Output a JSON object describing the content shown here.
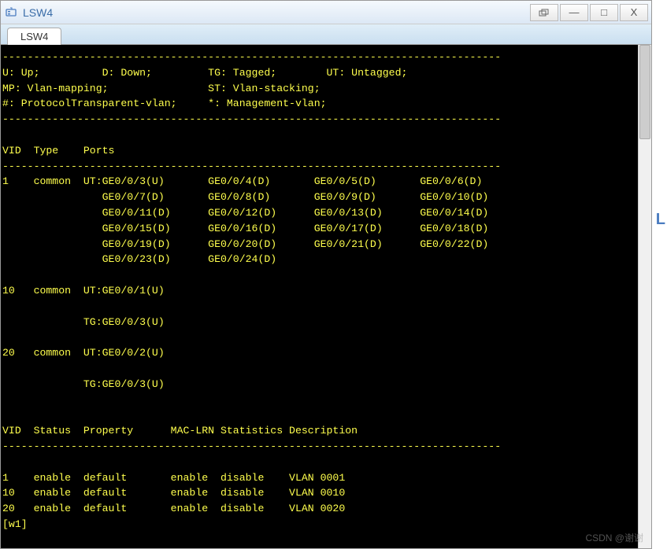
{
  "window": {
    "title": "LSW4",
    "tab": "LSW4"
  },
  "controls": {
    "extra": "▭",
    "minimize": "—",
    "maximize": "□",
    "close": "X"
  },
  "terminal": {
    "dashline": "--------------------------------------------------------------------------------",
    "legend": {
      "l1": "U: Up;          D: Down;         TG: Tagged;        UT: Untagged;",
      "l2": "MP: Vlan-mapping;                ST: Vlan-stacking;",
      "l3": "#: ProtocolTransparent-vlan;     *: Management-vlan;"
    },
    "headers": {
      "ports": "VID  Type    Ports",
      "status": "VID  Status  Property      MAC-LRN Statistics Description"
    },
    "vlan_ports": [
      "1    common  UT:GE0/0/3(U)       GE0/0/4(D)       GE0/0/5(D)       GE0/0/6(D)",
      "                GE0/0/7(D)       GE0/0/8(D)       GE0/0/9(D)       GE0/0/10(D)",
      "                GE0/0/11(D)      GE0/0/12(D)      GE0/0/13(D)      GE0/0/14(D)",
      "                GE0/0/15(D)      GE0/0/16(D)      GE0/0/17(D)      GE0/0/18(D)",
      "                GE0/0/19(D)      GE0/0/20(D)      GE0/0/21(D)      GE0/0/22(D)",
      "                GE0/0/23(D)      GE0/0/24(D)",
      "",
      "10   common  UT:GE0/0/1(U)",
      "",
      "             TG:GE0/0/3(U)",
      "",
      "20   common  UT:GE0/0/2(U)",
      "",
      "             TG:GE0/0/3(U)"
    ],
    "vlan_status": [
      "1    enable  default       enable  disable    VLAN 0001",
      "10   enable  default       enable  disable    VLAN 0010",
      "20   enable  default       enable  disable    VLAN 0020"
    ],
    "prompt": "[w1]"
  },
  "chart_data": {
    "type": "table",
    "title": "VLAN Port/Status Table",
    "legend_map": {
      "U": "Up",
      "D": "Down",
      "TG": "Tagged",
      "UT": "Untagged",
      "MP": "Vlan-mapping",
      "ST": "Vlan-stacking",
      "#": "ProtocolTransparent-vlan",
      "*": "Management-vlan"
    },
    "vlans": [
      {
        "vid": 1,
        "type": "common",
        "untagged": [
          "GE0/0/3(U)",
          "GE0/0/4(D)",
          "GE0/0/5(D)",
          "GE0/0/6(D)",
          "GE0/0/7(D)",
          "GE0/0/8(D)",
          "GE0/0/9(D)",
          "GE0/0/10(D)",
          "GE0/0/11(D)",
          "GE0/0/12(D)",
          "GE0/0/13(D)",
          "GE0/0/14(D)",
          "GE0/0/15(D)",
          "GE0/0/16(D)",
          "GE0/0/17(D)",
          "GE0/0/18(D)",
          "GE0/0/19(D)",
          "GE0/0/20(D)",
          "GE0/0/21(D)",
          "GE0/0/22(D)",
          "GE0/0/23(D)",
          "GE0/0/24(D)"
        ],
        "tagged": [],
        "status": "enable",
        "property": "default",
        "mac_lrn": "enable",
        "statistics": "disable",
        "description": "VLAN 0001"
      },
      {
        "vid": 10,
        "type": "common",
        "untagged": [
          "GE0/0/1(U)"
        ],
        "tagged": [
          "GE0/0/3(U)"
        ],
        "status": "enable",
        "property": "default",
        "mac_lrn": "enable",
        "statistics": "disable",
        "description": "VLAN 0010"
      },
      {
        "vid": 20,
        "type": "common",
        "untagged": [
          "GE0/0/2(U)"
        ],
        "tagged": [
          "GE0/0/3(U)"
        ],
        "status": "enable",
        "property": "default",
        "mac_lrn": "enable",
        "statistics": "disable",
        "description": "VLAN 0020"
      }
    ]
  },
  "misc": {
    "right_letter": "L",
    "watermark": "CSDN @谢谢"
  }
}
